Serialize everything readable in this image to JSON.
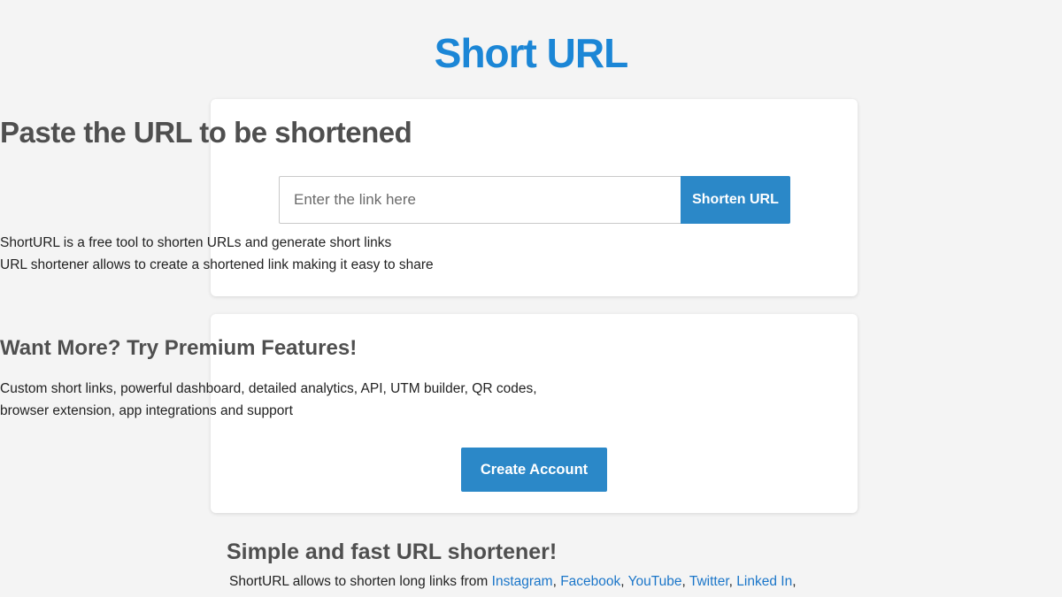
{
  "header": {
    "logo_text": "Short URL"
  },
  "shorten_card": {
    "heading": "Paste the URL to be shortened",
    "input_placeholder": "Enter the link here",
    "input_value": "",
    "button_label": "Shorten URL",
    "desc_line1": "ShortURL is a free tool to shorten URLs and generate short links",
    "desc_line2": "URL shortener allows to create a shortened link making it easy to share"
  },
  "premium_card": {
    "heading": "Want More? Try Premium Features!",
    "desc_line1": "Custom short links, powerful dashboard, detailed analytics, API, UTM builder, QR codes,",
    "desc_line2": "browser extension, app integrations and support",
    "button_label": "Create Account"
  },
  "info_section": {
    "heading": "Simple and fast URL shortener!",
    "text_prefix": "ShortURL allows to shorten long links from ",
    "links": [
      "Instagram",
      "Facebook",
      "YouTube",
      "Twitter",
      "Linked In"
    ],
    "separator": ", ",
    "trailing": ","
  },
  "colors": {
    "brand": "#1b86d6",
    "button": "#2b88c8",
    "link": "#1b76c9",
    "background": "#f4f4f4"
  }
}
